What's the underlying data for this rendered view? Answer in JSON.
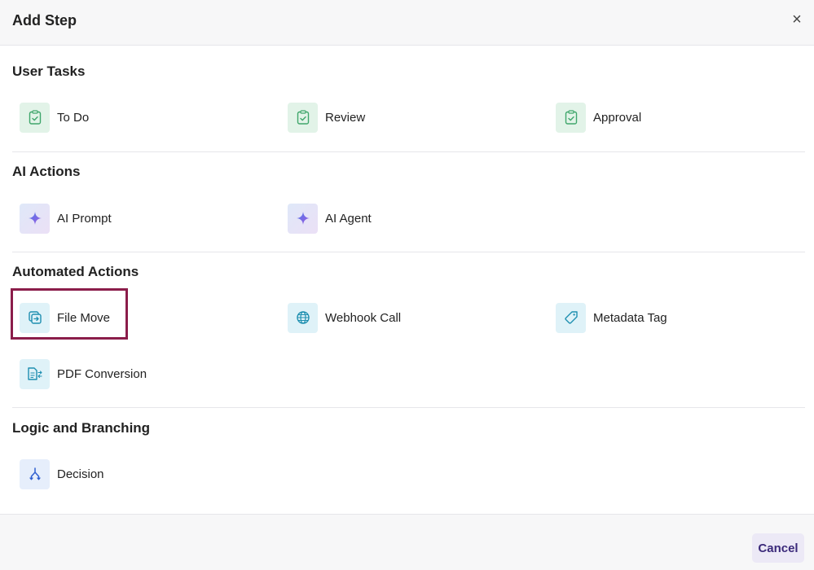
{
  "dialog": {
    "title": "Add Step",
    "close_glyph": "×"
  },
  "sections": {
    "user_tasks": {
      "title": "User Tasks",
      "items": [
        {
          "label": "To Do",
          "icon": "clipboard-check-icon"
        },
        {
          "label": "Review",
          "icon": "clipboard-check-icon"
        },
        {
          "label": "Approval",
          "icon": "clipboard-check-icon"
        }
      ]
    },
    "ai_actions": {
      "title": "AI Actions",
      "items": [
        {
          "label": "AI Prompt",
          "icon": "sparkle-icon"
        },
        {
          "label": "AI Agent",
          "icon": "sparkle-icon"
        }
      ]
    },
    "automated_actions": {
      "title": "Automated Actions",
      "items": [
        {
          "label": "File Move",
          "icon": "file-move-icon"
        },
        {
          "label": "Webhook Call",
          "icon": "globe-icon"
        },
        {
          "label": "Metadata Tag",
          "icon": "tag-icon"
        },
        {
          "label": "PDF Conversion",
          "icon": "pdf-convert-icon"
        }
      ]
    },
    "logic": {
      "title": "Logic and Branching",
      "items": [
        {
          "label": "Decision",
          "icon": "decision-branch-icon"
        }
      ]
    }
  },
  "footer": {
    "cancel_label": "Cancel"
  },
  "colors": {
    "highlight": "#8b1d4a",
    "green_icon": "#3fa66b",
    "cyan_icon": "#1e8fb0",
    "blue_icon": "#2f5fd0",
    "cancel_text": "#3b2a7a"
  }
}
